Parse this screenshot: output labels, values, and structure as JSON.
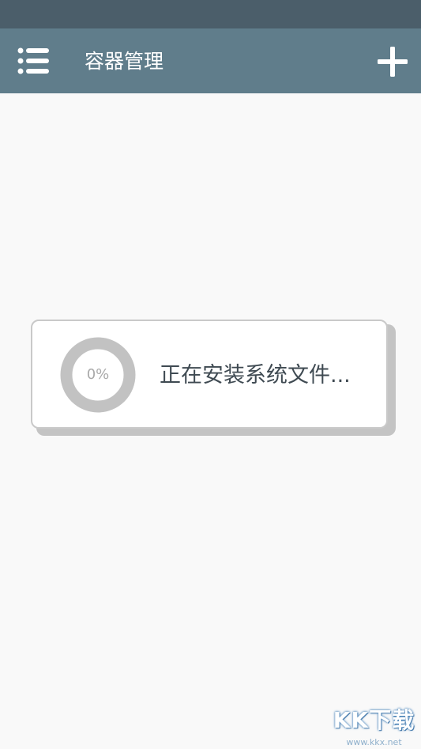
{
  "app_bar": {
    "title": "容器管理",
    "menu_icon": "menu-list-icon",
    "add_icon": "plus-icon",
    "color": "#607d8b"
  },
  "status_bar": {
    "color": "#4b5e6a"
  },
  "dialog": {
    "progress_percent": 0,
    "progress_label": "0%",
    "message": "正在安装系统文件..."
  },
  "watermark": {
    "logo": "KK下载",
    "url": "www.kkx.net"
  }
}
